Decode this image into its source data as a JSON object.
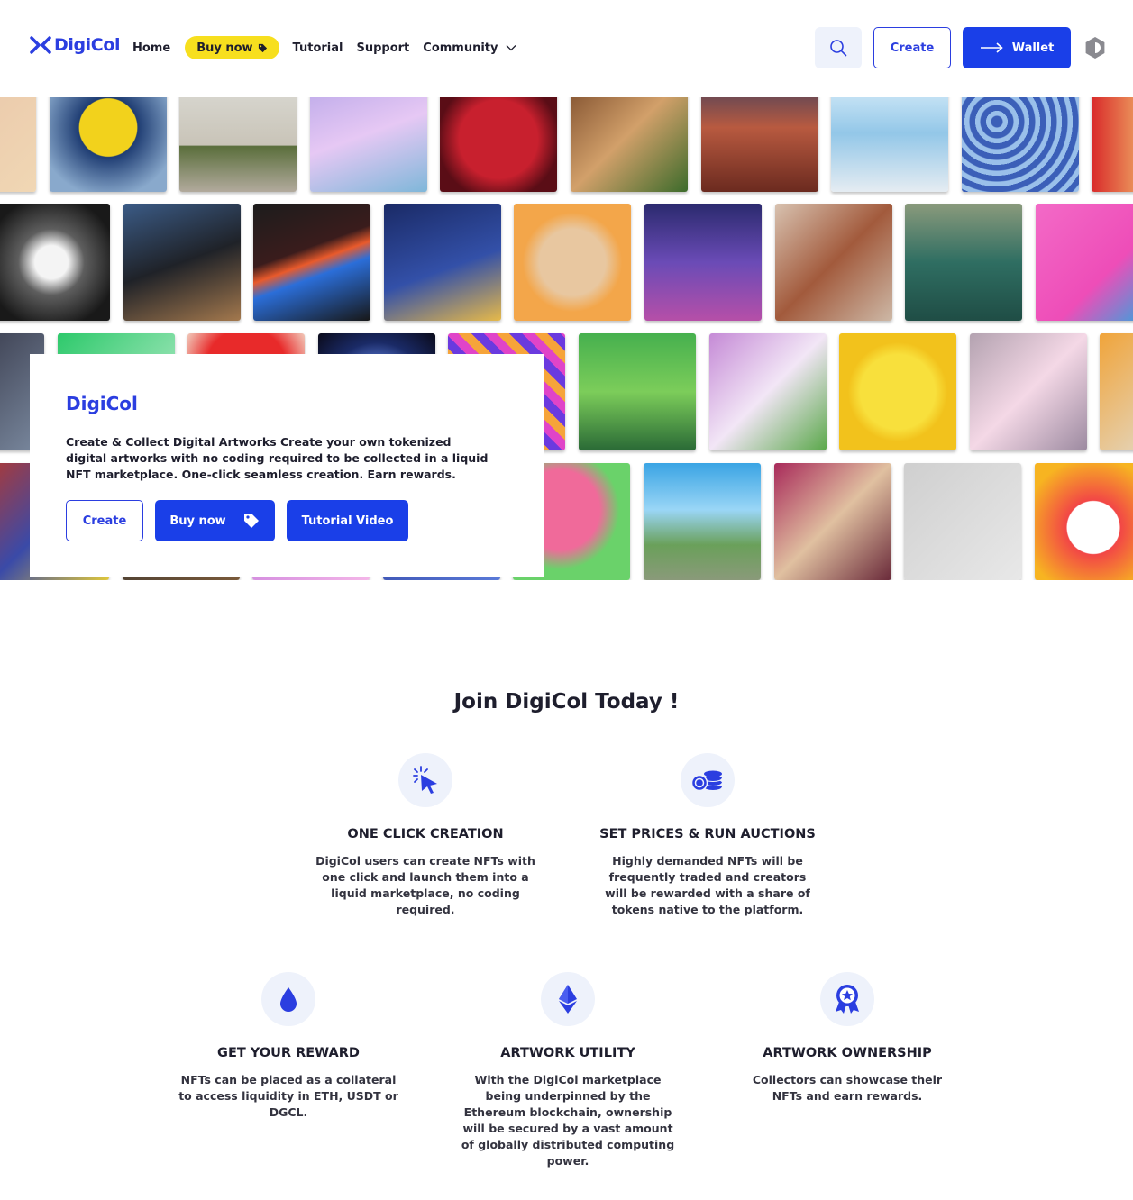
{
  "brand": {
    "name": "DigiCol",
    "accent": "#2b3ee0",
    "button_blue": "#1a3fe8",
    "pill_yellow": "#f7df1e"
  },
  "nav": {
    "home": "Home",
    "buy_now": "Buy now",
    "tutorial": "Tutorial",
    "support": "Support",
    "community": "Community"
  },
  "header_actions": {
    "create": "Create",
    "wallet": "Wallet"
  },
  "hero": {
    "title": "DigiCol",
    "description": "Create & Collect Digital Artworks Create your own tokenized digital artworks with no coding required to be collected in a liquid NFT marketplace. One-click seamless creation. Earn rewards.",
    "create": "Create",
    "buy_now": "Buy now",
    "tutorial_video": "Tutorial Video"
  },
  "gallery": {
    "tiles": [
      {
        "bg": "linear-gradient(135deg,#e9c4a8,#f0d7b4)"
      },
      {
        "bg": "radial-gradient(circle at 50% 45%,#f2d21c 0 33%,#1f3d73 34%,#89a9cc 80%)"
      },
      {
        "bg": "linear-gradient(180deg,#dcdcd6,#c9c4b8 60%,#5a6e3b 61%,#b2aa9d)"
      },
      {
        "bg": "linear-gradient(160deg,#b7a6e8,#e6c8f4 50%,#7fb7d9)"
      },
      {
        "bg": "radial-gradient(circle at 50% 55%,#c8202e 0 45%,#5a0d16 70%)"
      },
      {
        "bg": "linear-gradient(135deg,#7a4a2a,#d2a06a 50%,#3c6b2b)"
      },
      {
        "bg": "linear-gradient(180deg,#3f3f5e,#b85a40 45%,#6b2a1f)"
      },
      {
        "bg": "linear-gradient(180deg,#dff1fb,#93c7e8 50%,#e5ecf2)"
      },
      {
        "bg": "repeating-radial-gradient(circle at 30% 40%,#3b5fb8 0 6px,#9ac0ea 7px 12px)"
      },
      {
        "bg": "linear-gradient(90deg,#d92a2a,#f0b46a 50%,#3a9a3a)"
      },
      {
        "bg": "radial-gradient(circle,#f4f4f4 0 20%,#5e5e5e 40%,#191919 80%)"
      },
      {
        "bg": "linear-gradient(160deg,#3b5b86,#1f2228 50%,#a3784d)"
      },
      {
        "bg": "linear-gradient(160deg,#1c1c1c,#3a1c1c 40%,#e95a2b 50%,#2b6ed9 60%,#171717)"
      },
      {
        "bg": "linear-gradient(160deg,#1a2a66,#3350a8 55%,#e6b94a)"
      },
      {
        "bg": "radial-gradient(circle at 50% 50%,#e8c7a0 0 40%,#f3a64a 60%)"
      },
      {
        "bg": "linear-gradient(180deg,#2b2a6e,#6a4bb6 50%,#b64fa8)"
      },
      {
        "bg": "linear-gradient(135deg,#d8c2b0,#a25a3c 50%,#cdb8a6)"
      },
      {
        "bg": "linear-gradient(180deg,#8a9a7c,#2f6e62 50%,#1f4d45)"
      },
      {
        "bg": "linear-gradient(135deg,#f36ac7,#ee4db8 60%,#2aa9e0)"
      },
      {
        "bg": "linear-gradient(135deg,#2a2a3a,#7b8aa0)"
      },
      {
        "bg": "linear-gradient(135deg,#2dc96b,#c9f0d6)"
      },
      {
        "bg": "radial-gradient(circle at 50% 30%,#e82a2a 0 40%,#f2d6c6 70%)"
      },
      {
        "bg": "radial-gradient(circle,#6a8ef0 0 25%,#1a2a66 60%,#0a0a1a)"
      },
      {
        "bg": "repeating-linear-gradient(45deg,#e044c8 0 10px,#f6a43a 10px 20px,#6a3adf 20px 30px)"
      },
      {
        "bg": "linear-gradient(180deg,#46b04e,#7ccd5a 50%,#2a6a36)"
      },
      {
        "bg": "linear-gradient(135deg,#c58ad6,#f2e6f6 50%,#5aa84a)"
      },
      {
        "bg": "radial-gradient(circle,#f8e03c 0 45%,#f2c21c 60%)"
      },
      {
        "bg": "linear-gradient(135deg,#b3a2b0,#f4d8e6 50%,#9c8aa0)"
      },
      {
        "bg": "linear-gradient(135deg,#f0a43a,#dfe8ee)"
      },
      {
        "bg": "linear-gradient(135deg,#a83a3a,#3a4aa8 50%,#e0c83a)"
      },
      {
        "bg": "linear-gradient(135deg,#2e2e2e,#7a5a3a)"
      },
      {
        "bg": "linear-gradient(135deg,#b86ad8,#f4b6e8)"
      },
      {
        "bg": "linear-gradient(135deg,#2a3a9a,#5a7ad8)"
      },
      {
        "bg": "radial-gradient(circle at 40% 40%,#f06a9a 0 40%,#6ad26a 60%)"
      },
      {
        "bg": "linear-gradient(180deg,#3aa4e4,#9ad6f6 40%,#6aa05a 70%,#8a9a7a)"
      },
      {
        "bg": "linear-gradient(135deg,#a82a5a,#e0c0a0 50%,#6a2a3a)"
      },
      {
        "bg": "linear-gradient(135deg,#cfcfcf,#e8e8e8)"
      },
      {
        "bg": "radial-gradient(circle at 50% 55%,#ffffff 0 30%,#f24646 31%,#f7b421 80%)"
      }
    ]
  },
  "join": {
    "title": "Join DigiCol Today !",
    "features": [
      {
        "icon": "cursor-click-icon",
        "title": "ONE CLICK CREATION",
        "desc": "DigiCol users can create NFTs with one click and launch them into a liquid marketplace, no coding required."
      },
      {
        "icon": "coins-icon",
        "title": "SET PRICES & RUN AUCTIONS",
        "desc": "Highly demanded NFTs will be frequently traded and creators will be rewarded with a share of tokens native to the platform."
      },
      {
        "icon": "drop-icon",
        "title": "GET YOUR REWARD",
        "desc": "NFTs can be placed as a collateral to access liquidity in ETH, USDT or DGCL."
      },
      {
        "icon": "ethereum-icon",
        "title": "ARTWORK UTILITY",
        "desc": "With the DigiCol marketplace being underpinned by the Ethereum blockchain, ownership will be secured by a vast amount of globally distributed computing power."
      },
      {
        "icon": "award-icon",
        "title": "ARTWORK OWNERSHIP",
        "desc": "Collectors can showcase their NFTs and earn rewards."
      }
    ]
  }
}
